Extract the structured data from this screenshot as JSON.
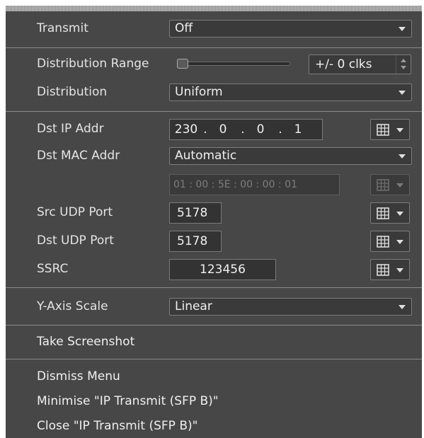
{
  "transmit": {
    "label": "Transmit",
    "value": "Off"
  },
  "distribution_range": {
    "label": "Distribution Range",
    "value": "+/- 0 clks",
    "slider_fraction": 0
  },
  "distribution": {
    "label": "Distribution",
    "value": "Uniform"
  },
  "dst_ip": {
    "label": "Dst IP Addr",
    "octets": [
      "230",
      "0",
      "0",
      "1"
    ],
    "dot": "."
  },
  "dst_mac": {
    "label": "Dst MAC Addr",
    "mode": "Automatic",
    "value": "01 : 00 : 5E : 00 : 00 : 01"
  },
  "src_udp": {
    "label": "Src UDP Port",
    "value": "5178"
  },
  "dst_udp": {
    "label": "Dst UDP Port",
    "value": "5178"
  },
  "ssrc": {
    "label": "SSRC",
    "value": "123456"
  },
  "y_axis": {
    "label": "Y-Axis Scale",
    "value": "Linear"
  },
  "actions": {
    "take_screenshot": "Take Screenshot",
    "dismiss_menu": "Dismiss Menu",
    "minimise": "Minimise \"IP Transmit (SFP B)\"",
    "close": "Close \"IP Transmit (SFP B)\""
  },
  "icons": {
    "keypad": "keypad-grid-icon",
    "dropdown": "chevron-down-icon"
  },
  "colors": {
    "panel_bg": "#474747",
    "field_bg": "#3a3a3a",
    "text": "#e6e6e6",
    "disabled_text": "#7d7d7d"
  }
}
